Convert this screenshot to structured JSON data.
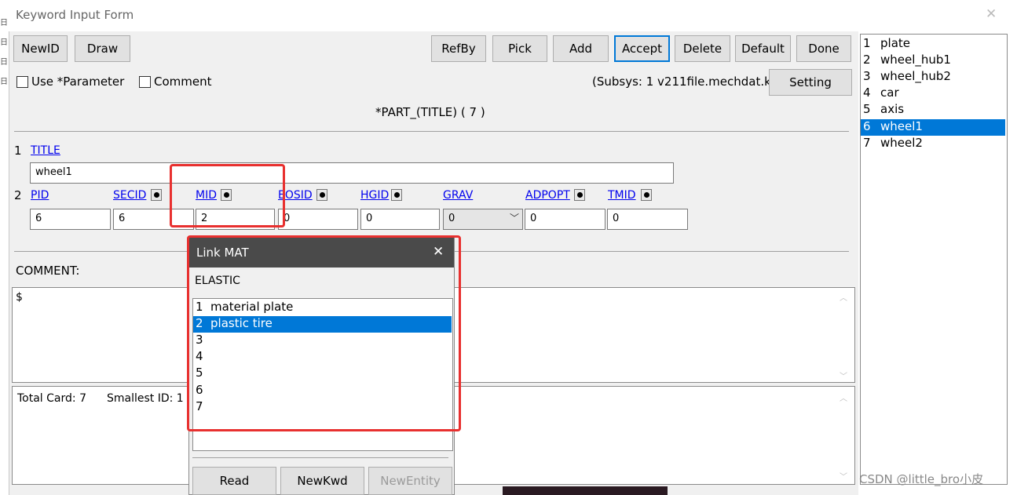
{
  "window": {
    "title": "Keyword Input Form",
    "close_glyph": "✕"
  },
  "toolbar": {
    "left_buttons": [
      "NewID",
      "Draw"
    ],
    "right_buttons": [
      "RefBy",
      "Pick",
      "Add",
      "Accept",
      "Delete",
      "Default",
      "Done"
    ]
  },
  "options": {
    "use_parameter": "Use *Parameter",
    "comment": "Comment",
    "subsys": "(Subsys: 1 v211file.mechdat.k)",
    "setting": "Setting"
  },
  "keyword": {
    "header": "*PART_(TITLE)    ( 7 )"
  },
  "card1": {
    "row_num": "1",
    "title_label": "TITLE",
    "title_value": "wheel1"
  },
  "card2": {
    "row_num": "2",
    "fields": [
      {
        "label": "PID",
        "value": "6",
        "has_dot": false
      },
      {
        "label": "SECID",
        "value": "6",
        "has_dot": true
      },
      {
        "label": "MID",
        "value": "2",
        "has_dot": true
      },
      {
        "label": "EOSID",
        "value": "0",
        "has_dot": true
      },
      {
        "label": "HGID",
        "value": "0",
        "has_dot": true
      },
      {
        "label": "GRAV",
        "value": "0",
        "has_dot": false
      },
      {
        "label": "ADPOPT",
        "value": "0",
        "has_dot": true
      },
      {
        "label": "TMID",
        "value": "0",
        "has_dot": true
      }
    ]
  },
  "comment": {
    "label": "COMMENT:",
    "text": "$"
  },
  "status": {
    "total_card": "Total Card: 7",
    "smallest_id": "Smallest ID: 1"
  },
  "part_list": [
    {
      "num": "1",
      "name": "plate",
      "selected": false
    },
    {
      "num": "2",
      "name": "wheel_hub1",
      "selected": false
    },
    {
      "num": "3",
      "name": "wheel_hub2",
      "selected": false
    },
    {
      "num": "4",
      "name": "car",
      "selected": false
    },
    {
      "num": "5",
      "name": "axis",
      "selected": false
    },
    {
      "num": "6",
      "name": "wheel1",
      "selected": true
    },
    {
      "num": "7",
      "name": "wheel2",
      "selected": false
    }
  ],
  "link_dialog": {
    "title": "Link MAT",
    "close_glyph": "✕",
    "category": "ELASTIC",
    "items": [
      {
        "num": "1",
        "name": "material plate",
        "selected": false
      },
      {
        "num": "2",
        "name": "plastic tire",
        "selected": true
      },
      {
        "num": "3",
        "name": "",
        "selected": false
      },
      {
        "num": "4",
        "name": "",
        "selected": false
      },
      {
        "num": "5",
        "name": "",
        "selected": false
      },
      {
        "num": "6",
        "name": "",
        "selected": false
      },
      {
        "num": "7",
        "name": "",
        "selected": false
      }
    ],
    "buttons": [
      "Read",
      "NewKwd",
      "NewEntity"
    ]
  },
  "watermark": "CSDN @little_bro小皮",
  "colors": {
    "selection": "#0078d7",
    "highlight_box": "#e8302f",
    "dialog_titlebar": "#4a4a4a"
  }
}
